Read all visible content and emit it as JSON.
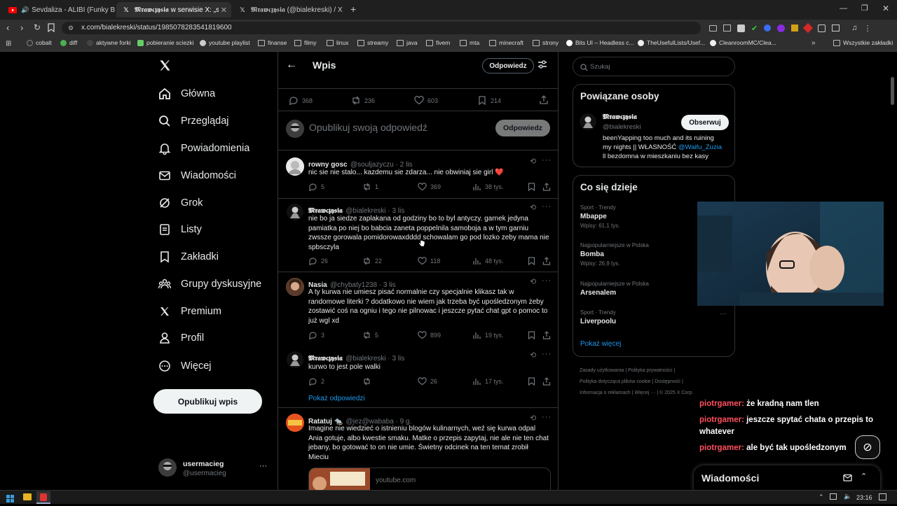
{
  "browser": {
    "tabs": [
      {
        "title": "Sevdaliza - ALIBI (Funky Beatz Bo",
        "icon": "youtube-icon"
      },
      {
        "title": "𝕸𝖗𝖆𝖜𝖈𝖟𝖞𝖘𝖎𝖆 w serwisie X: „spytala",
        "icon": "x-icon",
        "active": true
      },
      {
        "title": "𝕸𝖗𝖆𝖜𝖈𝖟𝖞𝖘𝖎𝖆 (@bialekreski) / X",
        "icon": "x-icon"
      }
    ],
    "url": "x.com/bialekreski/status/1985078283541819600",
    "bookmarks": [
      "cobalt",
      "diff",
      "aktywne forki",
      "pobieranie sciezki",
      "youtube playlist",
      "finanse",
      "filmy",
      "linux",
      "streamy",
      "java",
      "fivem",
      "mta",
      "minecraft",
      "strony",
      "Bits UI – Headless c...",
      "TheUsefulLists/Usef...",
      "CleanroomMC/Clea..."
    ],
    "all_bookmarks": "Wszystkie zakładki"
  },
  "nav": {
    "items": [
      "Główna",
      "Przeglądaj",
      "Powiadomienia",
      "Wiadomości",
      "Grok",
      "Listy",
      "Zakładki",
      "Grupy dyskusyjne",
      "Premium",
      "Profil",
      "Więcej"
    ],
    "post_button": "Opublikuj wpis",
    "user_name": "usermacieg",
    "user_handle": "@usermacieg"
  },
  "header": {
    "title": "Wpis",
    "reply_button": "Odpowiedz"
  },
  "main_stats": {
    "replies": "368",
    "reposts": "236",
    "likes": "603",
    "bookmarks": "214"
  },
  "composer": {
    "placeholder": "Opublikuj swoją odpowiedź",
    "button": "Odpowiedz"
  },
  "tweets": [
    {
      "name": "rowny gosc",
      "handle": "@souljazyczu · 2 lis",
      "text": "nic sie nie stalo... kazdemu sie zdarza... nie obwiniaj sie girl ❤️",
      "replies": "5",
      "reposts": "1",
      "likes": "369",
      "views": "38 tys."
    },
    {
      "name": "𝕸𝖗𝖆𝖜𝖈𝖟𝖞𝖘𝖎𝖆",
      "handle": "@bialekreski · 3 lis",
      "text": "nie bo ja siedze zaplakana od godziny bo to byl antyczy. garnek jedyna pamiatka po niej bo babcia zaneta poppelnila samoboja a w tym garniu zwssze gorowala pomidorowaxdddd schowalam go pod lozko zeby mama nie spbsczyla",
      "replies": "26",
      "reposts": "22",
      "likes": "118",
      "views": "48 tys."
    },
    {
      "name": "Nasia",
      "handle": "@chybaty1238 · 3 lis",
      "text": "A ty kurwa nie umiesz pisać normalnie czy specjalnie klikasz tak w randomowe literki ? dodatkowo nie wiem jak trzeba być upośledzonym żeby zostawić coś na ogniu i tego nie pilnowac i jeszcze pytać chat gpt o pomoc to już wgl xd",
      "replies": "3",
      "reposts": "5",
      "likes": "899",
      "views": "19 tys."
    },
    {
      "name": "𝕸𝖗𝖆𝖜𝖈𝖟𝖞𝖘𝖎𝖆",
      "handle": "@bialekreski · 3 lis",
      "text": "kurwo to jest pole walki",
      "replies": "2",
      "reposts": "",
      "likes": "26",
      "views": "17 tys."
    },
    {
      "name": "Ratatuj 🐀",
      "handle": "@jez@wababa · 9 g.",
      "text": "Imagine nie wiedzieć o istnieniu blogów kulinarnych, weź się kurwa odpal Ania gotuje, albo kwestie smaku. Matke o przepis zapytaj, nie ale nie ten chat jebany, bo gotować to on nie umie. Świetny odcinek na ten temat zrobił Mieciu",
      "link": "youtube.com"
    }
  ],
  "show_replies": "Pokaż odpowiedzi",
  "search": {
    "placeholder": "Szukaj"
  },
  "related": {
    "title": "Powiązane osoby",
    "name": "𝕸𝖗𝖆𝖜𝖈𝖟𝖞𝖘𝖎𝖆",
    "handle": "@bialekreski",
    "follow": "Obserwuj",
    "bio_1": "beenYapping too much and its ruining",
    "bio_2": "my nights || WŁASNOŚĆ",
    "bio_mention": "@Waifu_Zuzia",
    "bio_3": "ll bezdomna w mieszkaniu bez kasy"
  },
  "trends": {
    "title": "Co się dzieje",
    "items": [
      {
        "category": "Sport · Trendy",
        "name": "Mbappe",
        "count": "Wpisy: 61,1 tys."
      },
      {
        "category": "Najpopularniejsze w Polska",
        "name": "Bomba",
        "count": "Wpisy: 26,9 tys."
      },
      {
        "category": "Najpopularniejsze w Polska",
        "name": "Arsenalem",
        "count": ""
      },
      {
        "category": "Sport · Trendy",
        "name": "Liverpoolu",
        "count": ""
      }
    ],
    "show_more": "Pokaż więcej"
  },
  "footer": {
    "line1": "Zasady użytkowania  |  Polityka prywatności  |",
    "line2": "Polityka dotycząca plików cookie  |  Dostępność  |",
    "line3": "Informacja o reklamach  |  Więcej ···  |  © 2025 X Corp."
  },
  "chat": [
    {
      "user": "piotrgamer:",
      "msg": "że kradną nam tlen"
    },
    {
      "user": "piotrgamer:",
      "msg": "jeszcze spytać chata o przepis to"
    },
    {
      "user": "",
      "msg": "whatever"
    },
    {
      "user": "piotrgamer:",
      "msg": "ale być tak upośledzonym"
    }
  ],
  "messages_bar": {
    "title": "Wiadomości"
  },
  "taskbar": {
    "time": "23:16"
  }
}
